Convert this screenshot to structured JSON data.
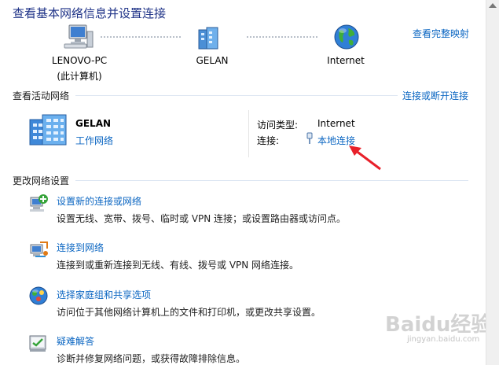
{
  "header": {
    "title": "查看基本网络信息并设置连接",
    "full_map_link": "查看完整映射"
  },
  "map": {
    "nodes": [
      {
        "name": "LENOVO-PC",
        "sub": "(此计算机)",
        "icon": "computer-icon"
      },
      {
        "name": "GELAN",
        "icon": "network-icon"
      },
      {
        "name": "Internet",
        "icon": "globe-icon"
      }
    ]
  },
  "active": {
    "section_label": "查看活动网络",
    "disconnect_link": "连接或断开连接",
    "network_name": "GELAN",
    "network_type": "工作网络",
    "access_type_label": "访问类型:",
    "access_type_value": "Internet",
    "connection_label": "连接:",
    "connection_value": "本地连接"
  },
  "change": {
    "section_label": "更改网络设置",
    "items": [
      {
        "title": "设置新的连接或网络",
        "desc": "设置无线、宽带、拨号、临时或 VPN 连接；或设置路由器或访问点。",
        "icon": "new-connection-icon"
      },
      {
        "title": "连接到网络",
        "desc": "连接到或重新连接到无线、有线、拨号或 VPN 网络连接。",
        "icon": "connect-network-icon"
      },
      {
        "title": "选择家庭组和共享选项",
        "desc": "访问位于其他网络计算机上的文件和打印机，或更改共享设置。",
        "icon": "homegroup-icon"
      },
      {
        "title": "疑难解答",
        "desc": "诊断并修复网络问题，或获得故障排除信息。",
        "icon": "troubleshoot-icon"
      }
    ]
  },
  "watermark": {
    "text": "Baidu经验",
    "url": "jingyan.baidu.com"
  },
  "colors": {
    "link": "#0b66c2",
    "title": "#1e3287",
    "annotation_arrow": "#e8202a"
  }
}
